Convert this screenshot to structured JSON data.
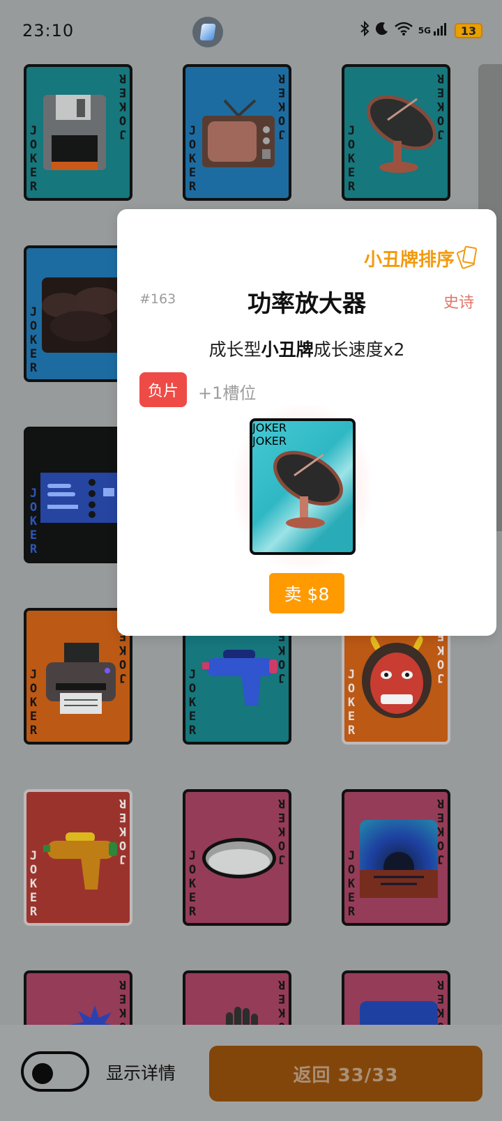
{
  "status_bar": {
    "time": "23:10",
    "network": "5G",
    "battery": "13"
  },
  "card_letters": "JOKER",
  "dialog": {
    "sort_link": "小丑牌排序",
    "number": "#163",
    "title": "功率放大器",
    "rarity": "史诗",
    "description_prefix": "成长型",
    "description_bold": "小丑牌",
    "description_suffix": "成长速度x2",
    "tag": "负片",
    "slot_text": "+1槽位",
    "sell_label": "卖 $8"
  },
  "bottom_bar": {
    "toggle_label": "显示详情",
    "toggle_on": false,
    "back_label": "返回 33/33"
  },
  "colors": {
    "accent": "#f29a0e",
    "sell": "#ff9a00",
    "tag": "#ee4b46",
    "rarity": "#e0766b",
    "back_button": "#83460a"
  },
  "cards": [
    {
      "subject": "floppy-disk",
      "background": "#127a80"
    },
    {
      "subject": "television",
      "background": "#1a6ea8"
    },
    {
      "subject": "satellite-dish",
      "background": "#127a80"
    },
    {
      "subject": "dark-clouds",
      "background": "#1a6ea8"
    },
    {
      "subject": "circuit-board",
      "background": "#0d0d0d"
    },
    {
      "subject": "printer",
      "background": "#c65a10"
    },
    {
      "subject": "water-gun",
      "background": "#127a80"
    },
    {
      "subject": "oni-mask",
      "background": "#c65a10"
    },
    {
      "subject": "water-gun",
      "background": "#a2302a"
    },
    {
      "subject": "hole",
      "background": "#9c3a58"
    },
    {
      "subject": "sunset",
      "background": "#9c3a58"
    },
    {
      "subject": "burst",
      "background": "#9c3a58"
    },
    {
      "subject": "hand",
      "background": "#9c3a58"
    },
    {
      "subject": "sunset",
      "background": "#9c3a58"
    }
  ]
}
